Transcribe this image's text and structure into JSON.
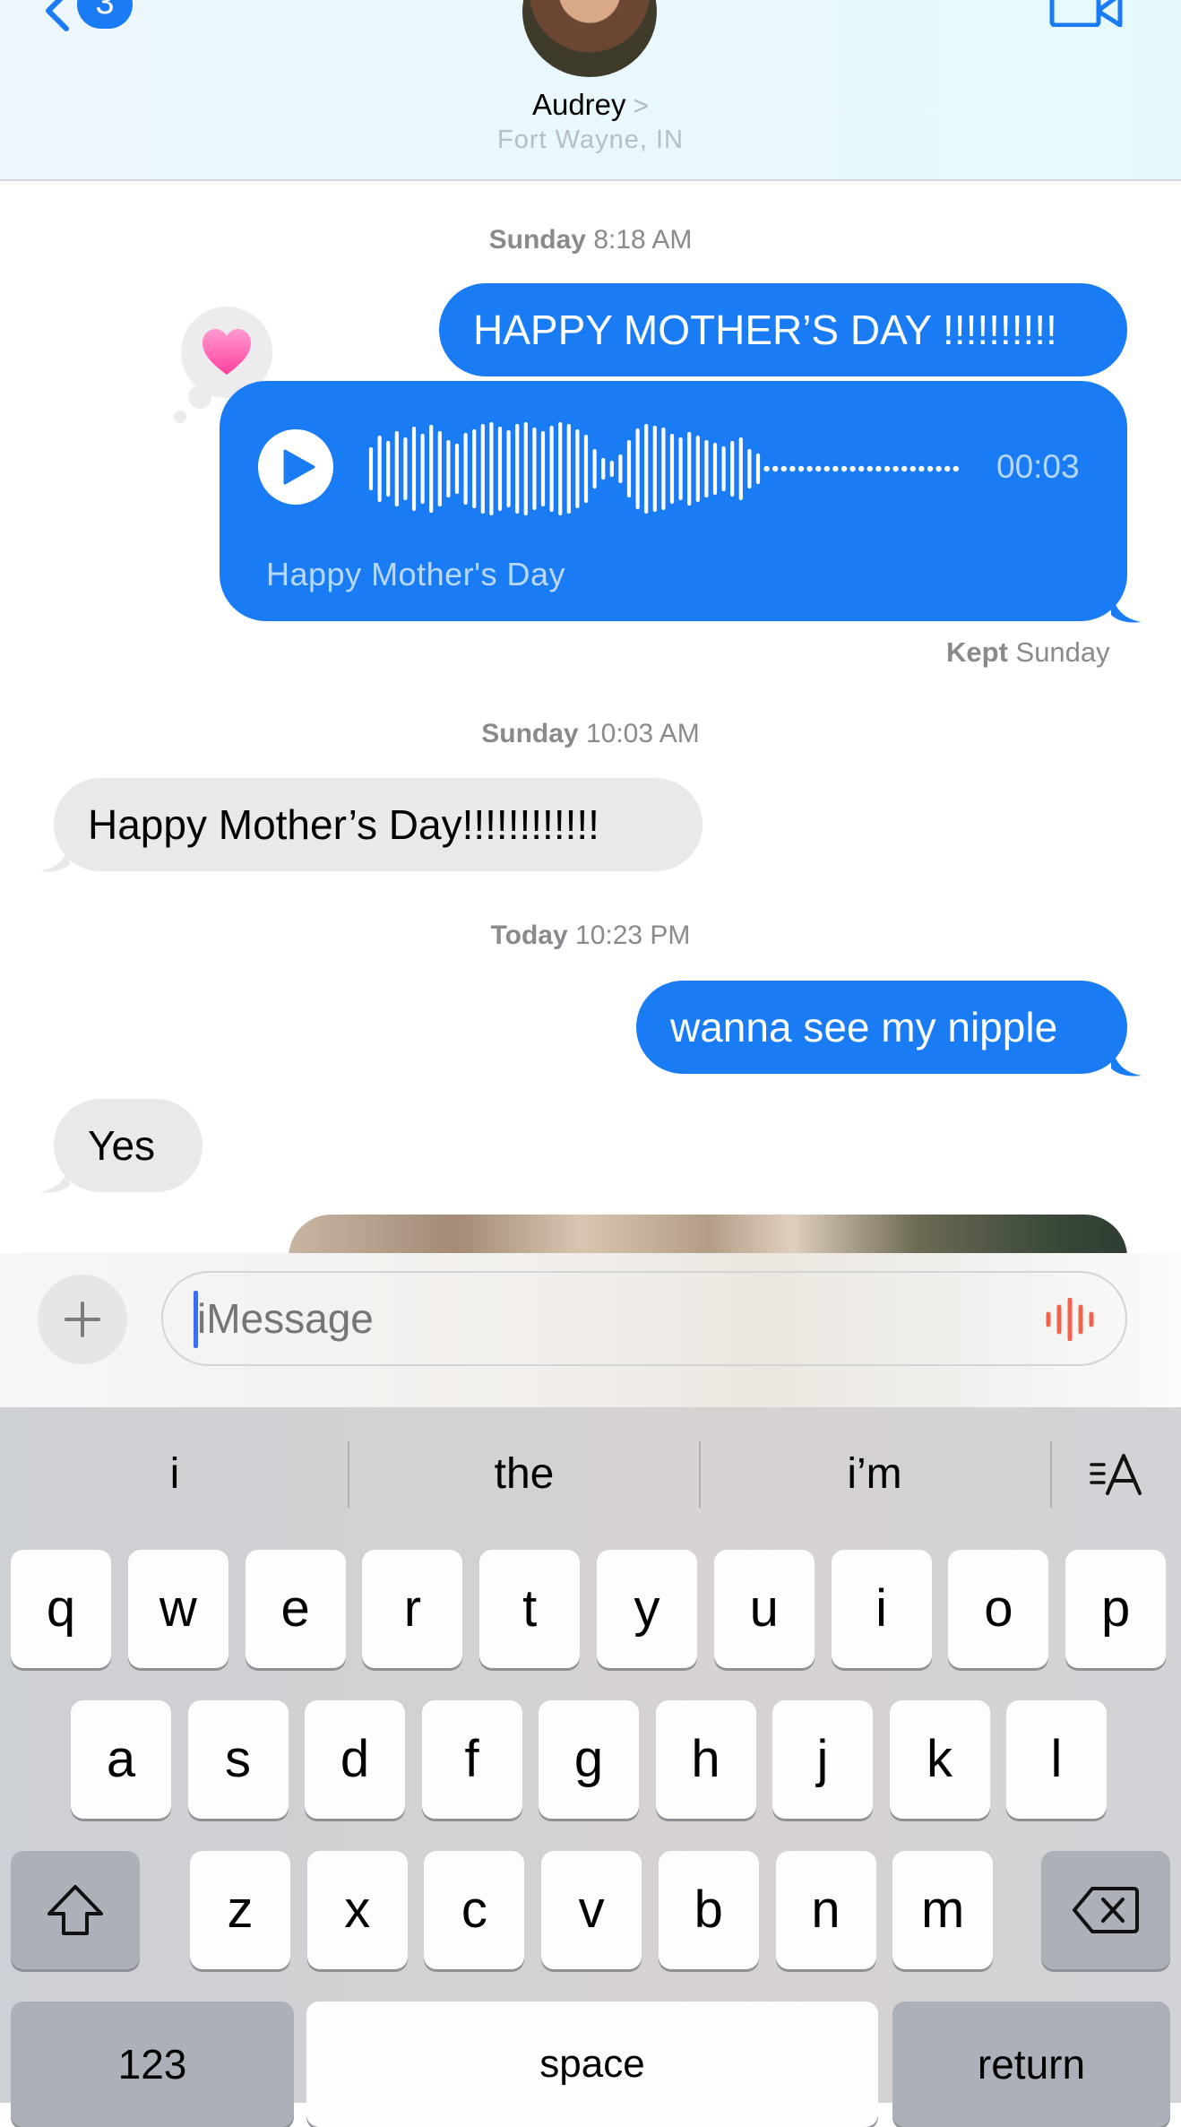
{
  "header": {
    "back_badge": "3",
    "contact_name": "Audrey",
    "contact_chevron": ">",
    "contact_location": "Fort Wayne, IN"
  },
  "messages": {
    "ts1_day": "Sunday",
    "ts1_time": "8:18 AM",
    "msg1": "HAPPY MOTHER’S DAY !!!!!!!!!!",
    "reaction": "❤",
    "audio_duration": "00:03",
    "audio_transcript": "Happy Mother's Day",
    "kept_label": "Kept",
    "kept_day": "Sunday",
    "ts2_day": "Sunday",
    "ts2_time": "10:03 AM",
    "msg2": "Happy Mother’s Day!!!!!!!!!!!!",
    "ts3_day": "Today",
    "ts3_time": "10:23 PM",
    "msg3": "wanna see my nipple",
    "msg4": "Yes"
  },
  "composer": {
    "placeholder": "iMessage",
    "plus_label": "+"
  },
  "keyboard": {
    "suggestions": [
      "i",
      "the",
      "i’m"
    ],
    "row1": [
      "q",
      "w",
      "e",
      "r",
      "t",
      "y",
      "u",
      "i",
      "o",
      "p"
    ],
    "row2": [
      "a",
      "s",
      "d",
      "f",
      "g",
      "h",
      "j",
      "k",
      "l"
    ],
    "row3": [
      "z",
      "x",
      "c",
      "v",
      "b",
      "n",
      "m"
    ],
    "num_key": "123",
    "space_key": "space",
    "return_key": "return"
  },
  "colors": {
    "outgoing_bubble": "#1a7cf5",
    "incoming_bubble": "#e9e9eb",
    "reaction_heart": "#ff69b4",
    "dictation": "#f0624a"
  }
}
